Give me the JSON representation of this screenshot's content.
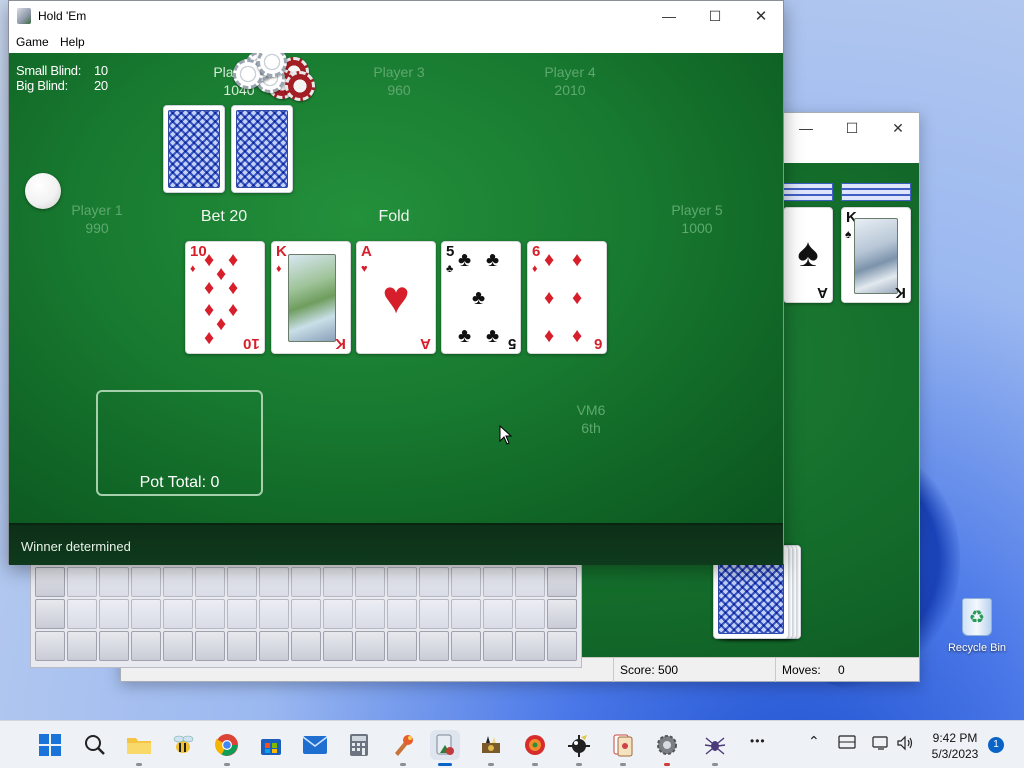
{
  "main_window": {
    "title": "Hold 'Em",
    "menu": [
      "Game",
      "Help"
    ],
    "status": "Winner determined"
  },
  "table": {
    "small_blind_label": "Small Blind:",
    "small_blind_value": "10",
    "big_blind_label": "Big Blind:",
    "big_blind_value": "20",
    "players": [
      {
        "name": "Player 1",
        "chips": "990"
      },
      {
        "name": "Player 2",
        "chips": "1040"
      },
      {
        "name": "Player 3",
        "chips": "960"
      },
      {
        "name": "Player 4",
        "chips": "2010"
      },
      {
        "name": "Player 5",
        "chips": "1000"
      },
      {
        "name": "VM6",
        "chips": "6th"
      }
    ],
    "actions": {
      "player1": "Bet 20",
      "player5": "Fold"
    },
    "community_cards": [
      {
        "rank": "10",
        "suit": "♦",
        "color": "#d61f2a"
      },
      {
        "rank": "K",
        "suit": "♦",
        "color": "#d61f2a"
      },
      {
        "rank": "A",
        "suit": "♥",
        "color": "#d61f2a"
      },
      {
        "rank": "5",
        "suit": "♣",
        "color": "#111111"
      },
      {
        "rank": "6",
        "suit": "♦",
        "color": "#d61f2a"
      }
    ],
    "pot_label": "Pot Total: 0"
  },
  "solitaire_window": {
    "score": "Score: 500",
    "moves_label": "Moves:",
    "moves_value": "0",
    "visible_cards": [
      {
        "rank": "A",
        "suit": "♠"
      },
      {
        "rank": "K",
        "suit": "♠"
      }
    ]
  },
  "desktop": {
    "recycle_bin": "Recycle Bin"
  },
  "taskbar": {
    "time": "9:42 PM",
    "date": "5/3/2023",
    "notifications": "1",
    "overflow": "•••",
    "apps": [
      "start-icon",
      "search-icon",
      "file-explorer-icon",
      "bee-game-icon",
      "chrome-icon",
      "store-icon",
      "mail-icon",
      "calculator-icon",
      "paint-icon",
      "hold-em-icon",
      "chess-icon",
      "game-icon",
      "minesweeper-icon",
      "solitaire-icon",
      "settings-icon",
      "spider-icon"
    ]
  },
  "colors": {
    "felt": "#187a30",
    "status_bar": "#0f3a1c",
    "accent": "#0a64c8"
  }
}
